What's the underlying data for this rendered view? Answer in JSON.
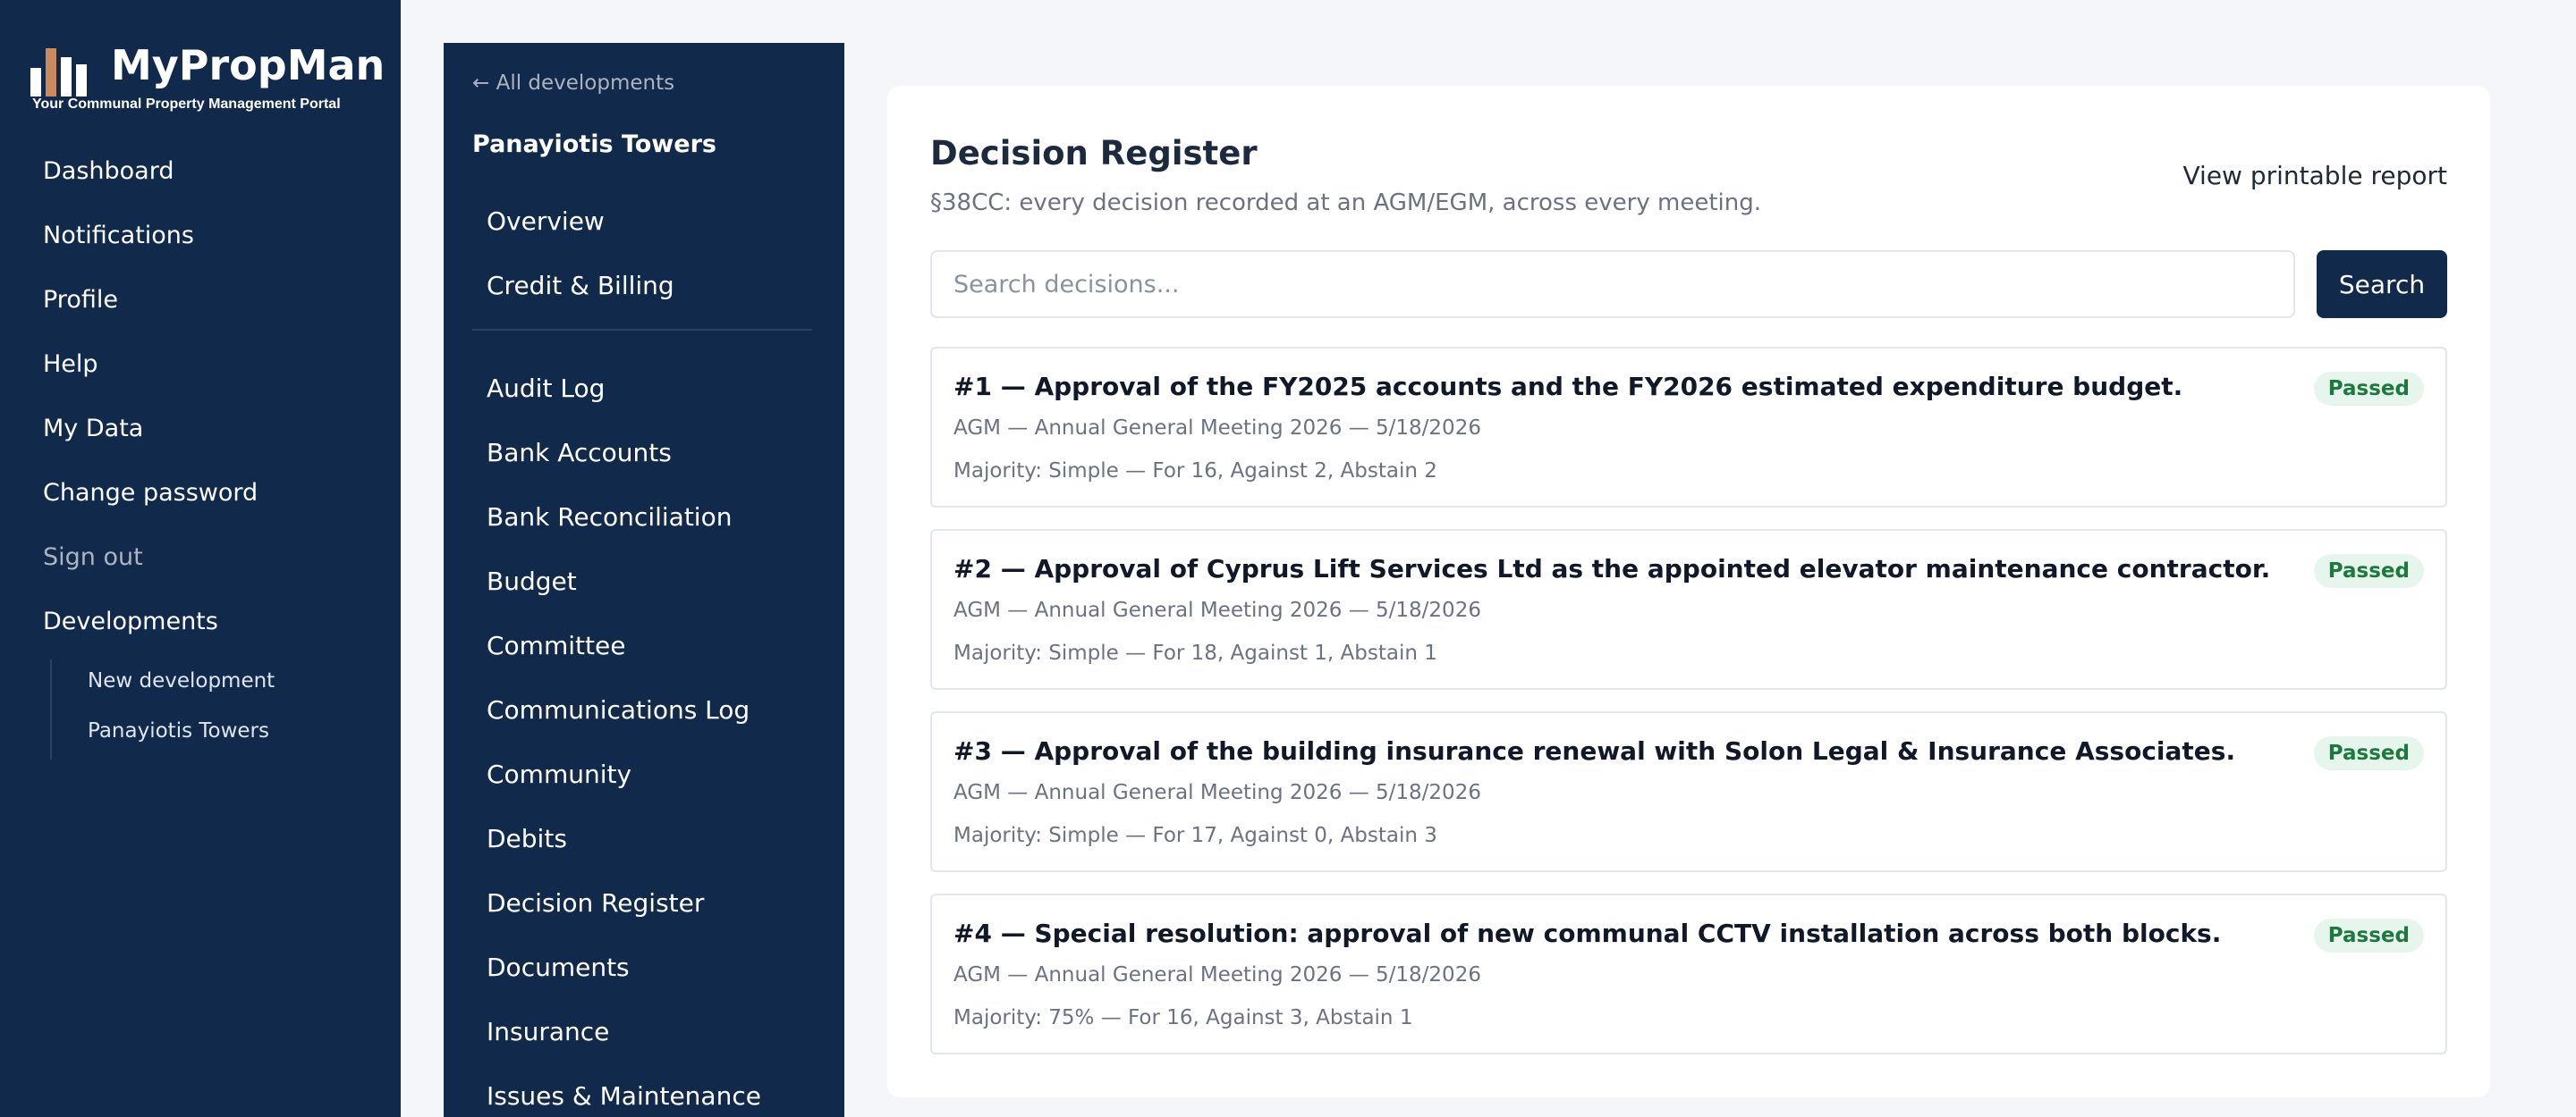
{
  "brand": {
    "name": "MyPropMan",
    "tagline": "Your Communal Property Management Portal",
    "logo_colors": [
      "#ffffff",
      "#c98a5e",
      "#ffffff",
      "#ffffff"
    ]
  },
  "sidebar": {
    "items": [
      {
        "label": "Dashboard"
      },
      {
        "label": "Notifications"
      },
      {
        "label": "Profile"
      },
      {
        "label": "Help"
      },
      {
        "label": "My Data"
      },
      {
        "label": "Change password"
      },
      {
        "label": "Sign out"
      },
      {
        "label": "Developments"
      }
    ],
    "sub_items": [
      {
        "label": "New development"
      },
      {
        "label": "Panayiotis Towers"
      }
    ]
  },
  "devnav": {
    "back_label": "← All developments",
    "development_name": "Panayiotis Towers",
    "primary_items": [
      {
        "label": "Overview"
      },
      {
        "label": "Credit & Billing"
      }
    ],
    "items": [
      {
        "label": "Audit Log"
      },
      {
        "label": "Bank Accounts"
      },
      {
        "label": "Bank Reconciliation"
      },
      {
        "label": "Budget"
      },
      {
        "label": "Committee"
      },
      {
        "label": "Communications Log"
      },
      {
        "label": "Community"
      },
      {
        "label": "Debits"
      },
      {
        "label": "Decision Register"
      },
      {
        "label": "Documents"
      },
      {
        "label": "Insurance"
      },
      {
        "label": "Issues & Maintenance"
      }
    ]
  },
  "main": {
    "title": "Decision Register",
    "subtitle": "§38CC: every decision recorded at an AGM/EGM, across every meeting.",
    "print_label": "View printable report",
    "search": {
      "placeholder": "Search decisions...",
      "value": "",
      "button_label": "Search"
    },
    "decisions": [
      {
        "title": "#1 — Approval of the FY2025 accounts and the FY2026 estimated expenditure budget.",
        "meeting": "AGM — Annual General Meeting 2026 — 5/18/2026",
        "majority": "Majority: Simple — For 16, Against 2, Abstain 2",
        "status": "Passed"
      },
      {
        "title": "#2 — Approval of Cyprus Lift Services Ltd as the appointed elevator maintenance contractor.",
        "meeting": "AGM — Annual General Meeting 2026 — 5/18/2026",
        "majority": "Majority: Simple — For 18, Against 1, Abstain 1",
        "status": "Passed"
      },
      {
        "title": "#3 — Approval of the building insurance renewal with Solon Legal & Insurance Associates.",
        "meeting": "AGM — Annual General Meeting 2026 — 5/18/2026",
        "majority": "Majority: Simple — For 17, Against 0, Abstain 3",
        "status": "Passed"
      },
      {
        "title": "#4 — Special resolution: approval of new communal CCTV installation across both blocks.",
        "meeting": "AGM — Annual General Meeting 2026 — 5/18/2026",
        "majority": "Majority: 75% — For 16, Against 3, Abstain 1",
        "status": "Passed"
      }
    ]
  },
  "colors": {
    "sidebar_bg": "#11294a",
    "page_bg": "#f4f6f9",
    "badge_bg": "#e7f6ec",
    "badge_text": "#1d7a3f"
  }
}
